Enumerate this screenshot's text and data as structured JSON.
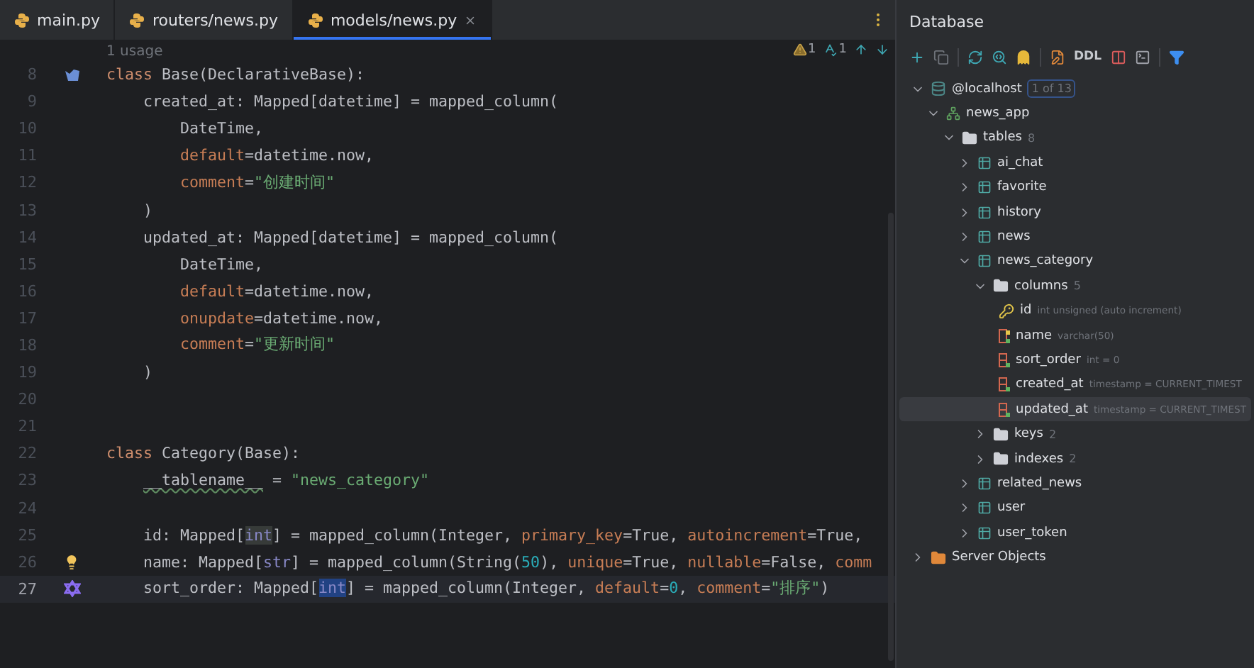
{
  "tabs": [
    {
      "label": "main.py",
      "selected": false
    },
    {
      "label": "routers/news.py",
      "selected": false
    },
    {
      "label": "models/news.py",
      "selected": true
    }
  ],
  "editor": {
    "usage_hint": "1 usage",
    "inspections": {
      "warnings": "1",
      "typos": "1"
    },
    "lines": [
      {
        "number": "8",
        "current": false,
        "marker": {
          "kind": "hierarchy"
        },
        "tokens": [
          {
            "kind": "keyword",
            "text": "class"
          },
          {
            "kind": "text",
            "text": " Base(DeclarativeBase):"
          }
        ],
        "children": [
          {
            "number": "9",
            "current": false,
            "tokens": [
              {
                "kind": "text",
                "text": "created_at: Mapped[datetime] = mapped_column("
              }
            ],
            "children": [
              {
                "number": "10",
                "current": false,
                "tokens": [
                  {
                    "kind": "text",
                    "text": "DateTime,"
                  }
                ]
              },
              {
                "number": "11",
                "current": false,
                "tokens": [
                  {
                    "kind": "param",
                    "text": "default"
                  },
                  {
                    "kind": "text",
                    "text": "=datetime.now,"
                  }
                ]
              },
              {
                "number": "12",
                "current": false,
                "tokens": [
                  {
                    "kind": "param",
                    "text": "comment"
                  },
                  {
                    "kind": "text",
                    "text": "="
                  },
                  {
                    "kind": "string",
                    "text": "\"创建时间\""
                  }
                ]
              }
            ]
          },
          {
            "number": "13",
            "current": false,
            "tokens": [
              {
                "kind": "text",
                "text": ")"
              }
            ]
          },
          {
            "number": "14",
            "current": false,
            "tokens": [
              {
                "kind": "text",
                "text": "updated_at: Mapped[datetime] = mapped_column("
              }
            ],
            "children": [
              {
                "number": "15",
                "current": false,
                "tokens": [
                  {
                    "kind": "text",
                    "text": "DateTime,"
                  }
                ]
              },
              {
                "number": "16",
                "current": false,
                "tokens": [
                  {
                    "kind": "param",
                    "text": "default"
                  },
                  {
                    "kind": "text",
                    "text": "=datetime.now,"
                  }
                ]
              },
              {
                "number": "17",
                "current": false,
                "tokens": [
                  {
                    "kind": "param",
                    "text": "onupdate"
                  },
                  {
                    "kind": "text",
                    "text": "=datetime.now,"
                  }
                ]
              },
              {
                "number": "18",
                "current": false,
                "tokens": [
                  {
                    "kind": "param",
                    "text": "comment"
                  },
                  {
                    "kind": "text",
                    "text": "="
                  },
                  {
                    "kind": "string",
                    "text": "\"更新时间\""
                  }
                ]
              }
            ]
          },
          {
            "number": "19",
            "current": false,
            "tokens": [
              {
                "kind": "text",
                "text": ")"
              }
            ]
          }
        ]
      },
      {
        "number": "20",
        "current": false
      },
      {
        "number": "21",
        "current": false
      },
      {
        "number": "22",
        "current": false,
        "tokens": [
          {
            "kind": "keyword",
            "text": "class"
          },
          {
            "kind": "text",
            "text": " Category(Base):"
          }
        ],
        "children": [
          {
            "number": "23",
            "current": false,
            "tokens": [
              {
                "kind": "flagged",
                "text": "__tablename__"
              },
              {
                "kind": "text",
                "text": " = "
              },
              {
                "kind": "string",
                "text": "\"news_category\""
              }
            ]
          },
          {
            "number": "24",
            "current": false
          },
          {
            "number": "25",
            "current": false,
            "tokens": [
              {
                "kind": "text",
                "text": "id: Mapped["
              },
              {
                "kind": "occurrence",
                "text": "int"
              },
              {
                "kind": "text",
                "text": "] = mapped_column(Integer, "
              },
              {
                "kind": "param",
                "text": "primary_key"
              },
              {
                "kind": "text",
                "text": "=True, "
              },
              {
                "kind": "param",
                "text": "autoincrement"
              },
              {
                "kind": "text",
                "text": "=True,"
              }
            ]
          },
          {
            "number": "26",
            "current": false,
            "marker": {
              "kind": "bulb"
            },
            "tokens": [
              {
                "kind": "text",
                "text": "name: Mapped["
              },
              {
                "kind": "builtin",
                "text": "str"
              },
              {
                "kind": "text",
                "text": "] = mapped_column(String("
              },
              {
                "kind": "number",
                "text": "50"
              },
              {
                "kind": "text",
                "text": "), "
              },
              {
                "kind": "param",
                "text": "unique"
              },
              {
                "kind": "text",
                "text": "=True, "
              },
              {
                "kind": "param",
                "text": "nullable"
              },
              {
                "kind": "text",
                "text": "=False, "
              },
              {
                "kind": "param",
                "text": "comm"
              }
            ]
          },
          {
            "number": "27",
            "current": true,
            "marker": {
              "kind": "implements"
            },
            "tokens": [
              {
                "kind": "text",
                "text": "sort_order: Mapped["
              },
              {
                "kind": "selection",
                "text": "int"
              },
              {
                "kind": "text",
                "text": "] = mapped_column(Integer, "
              },
              {
                "kind": "param",
                "text": "default"
              },
              {
                "kind": "text",
                "text": "="
              },
              {
                "kind": "number",
                "text": "0"
              },
              {
                "kind": "text",
                "text": ", "
              },
              {
                "kind": "param",
                "text": "comment"
              },
              {
                "kind": "text",
                "text": "="
              },
              {
                "kind": "string",
                "text": "\"排序\""
              },
              {
                "kind": "text",
                "text": ")"
              }
            ]
          }
        ]
      }
    ]
  },
  "database": {
    "title": "Database",
    "ddl_label": "DDL",
    "tree": [
      {
        "kind": "host",
        "label": "@localhost",
        "badge": "1 of 13",
        "expanded": true,
        "selected": false,
        "children": [
          {
            "kind": "schema",
            "label": "news_app",
            "expanded": true,
            "selected": false,
            "children": [
              {
                "kind": "folder",
                "label": "tables",
                "count": "8",
                "expanded": true,
                "selected": false,
                "children": [
                  {
                    "kind": "table",
                    "label": "ai_chat",
                    "expanded": false,
                    "selected": false
                  },
                  {
                    "kind": "table",
                    "label": "favorite",
                    "expanded": false,
                    "selected": false
                  },
                  {
                    "kind": "table",
                    "label": "history",
                    "expanded": false,
                    "selected": false
                  },
                  {
                    "kind": "table",
                    "label": "news",
                    "expanded": false,
                    "selected": false
                  },
                  {
                    "kind": "table",
                    "label": "news_category",
                    "expanded": true,
                    "selected": false,
                    "children": [
                      {
                        "kind": "folder",
                        "label": "columns",
                        "count": "5",
                        "expanded": true,
                        "selected": false,
                        "children": [
                          {
                            "kind": "key",
                            "label": "id",
                            "detail": "int unsigned (auto increment)",
                            "selected": false
                          },
                          {
                            "kind": "indexed",
                            "label": "name",
                            "detail": "varchar(50)",
                            "selected": false
                          },
                          {
                            "kind": "column",
                            "label": "sort_order",
                            "detail": "int = 0",
                            "selected": false
                          },
                          {
                            "kind": "column",
                            "label": "created_at",
                            "detail": "timestamp = CURRENT_TIMEST",
                            "selected": false
                          },
                          {
                            "kind": "column",
                            "label": "updated_at",
                            "detail": "timestamp = CURRENT_TIMEST",
                            "selected": true
                          }
                        ]
                      },
                      {
                        "kind": "folder",
                        "label": "keys",
                        "count": "2",
                        "expanded": false,
                        "selected": false
                      },
                      {
                        "kind": "folder",
                        "label": "indexes",
                        "count": "2",
                        "expanded": false,
                        "selected": false
                      }
                    ]
                  },
                  {
                    "kind": "table",
                    "label": "related_news",
                    "expanded": false,
                    "selected": false
                  },
                  {
                    "kind": "table",
                    "label": "user",
                    "expanded": false,
                    "selected": false
                  },
                  {
                    "kind": "table",
                    "label": "user_token",
                    "expanded": false,
                    "selected": false
                  }
                ]
              }
            ]
          }
        ]
      },
      {
        "kind": "server",
        "label": "Server Objects",
        "expanded": false,
        "selected": false
      }
    ]
  }
}
